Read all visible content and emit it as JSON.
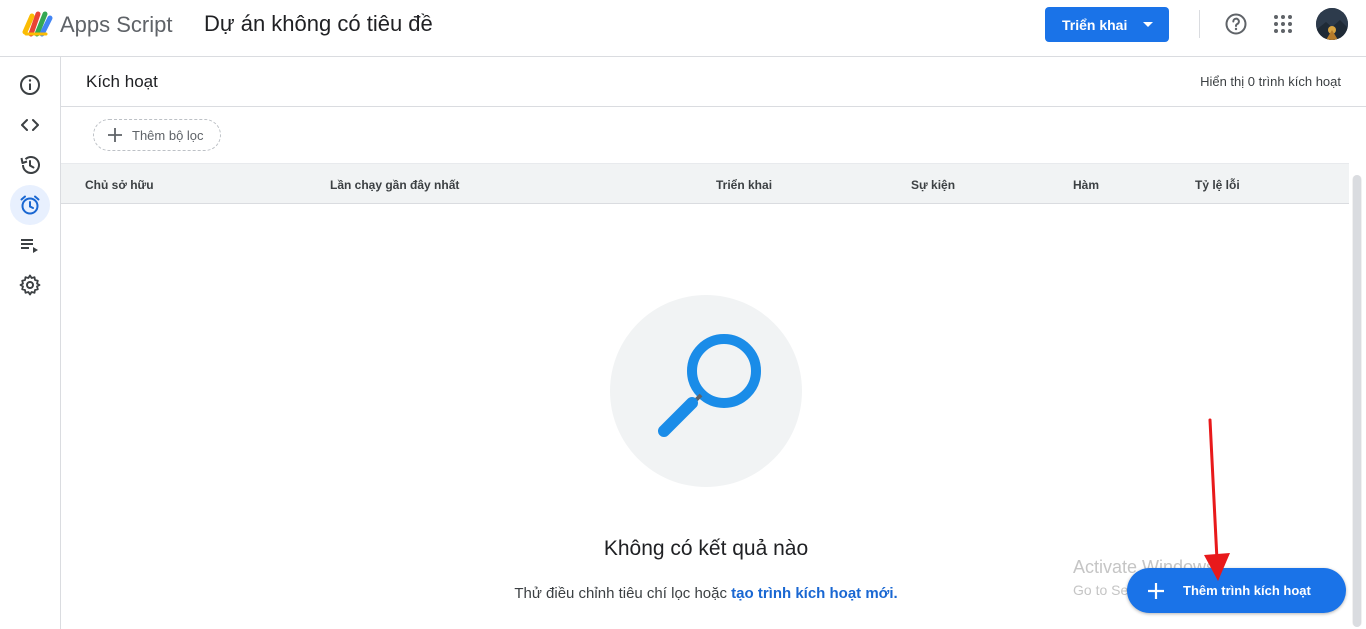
{
  "topbar": {
    "app_name": "Apps Script",
    "project_title": "Dự án không có tiêu đề",
    "deploy_label": "Triển khai",
    "help_icon": "help-circle-icon",
    "apps_icon": "apps-grid-icon"
  },
  "sidebar": {
    "items": [
      {
        "name": "overview",
        "icon": "info-icon"
      },
      {
        "name": "editor",
        "icon": "code-icon"
      },
      {
        "name": "history",
        "icon": "history-icon"
      },
      {
        "name": "triggers",
        "icon": "alarm-clock-icon",
        "active": true
      },
      {
        "name": "executions",
        "icon": "playlist-play-icon"
      },
      {
        "name": "settings",
        "icon": "gear-icon"
      }
    ]
  },
  "main": {
    "title": "Kích hoạt",
    "showing": "Hiển thị 0 trình kích hoạt",
    "filter_label": "Thêm bộ lọc",
    "columns": [
      "Chủ sở hữu",
      "Lần chạy gần đây nhất",
      "Triển khai",
      "Sự kiện",
      "Hàm",
      "Tỷ lệ lỗi"
    ],
    "empty_title": "Không có kết quả nào",
    "empty_sub_prefix": "Thử điều chỉnh tiêu chí lọc hoặc ",
    "empty_sub_link": "tạo trình kích hoạt mới."
  },
  "watermark": {
    "line1": "Activate Windows",
    "line2": "Go to Settings to activate Windows."
  },
  "fab": {
    "label": "Thêm trình kích hoạt"
  },
  "colors": {
    "accent": "#1a73e8",
    "link": "#1967d2",
    "annotation_arrow": "#e8191b"
  }
}
